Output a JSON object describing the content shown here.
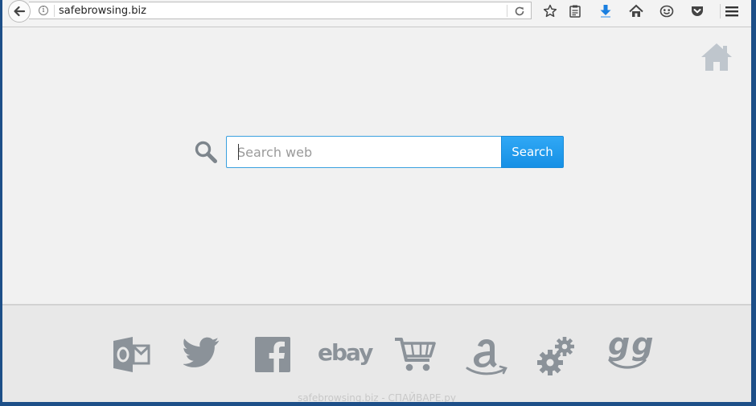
{
  "browser": {
    "url": "safebrowsing.biz",
    "toolbar_icons": [
      "bookmark-star-icon",
      "reading-list-icon",
      "download-icon",
      "home-icon",
      "hello-icon",
      "pocket-icon",
      "menu-icon"
    ]
  },
  "search": {
    "placeholder": "Search web",
    "button_label": "Search"
  },
  "footer": {
    "links": [
      "outlook",
      "twitter",
      "facebook",
      "ebay",
      "shopping-cart",
      "amazon",
      "settings",
      "gg"
    ],
    "ebay_label": "ebay",
    "gg_label": "gg",
    "watermark": "safebrowsing.biz - СПАЙВАРЕ.ру"
  },
  "colors": {
    "accent": "#1d9bf0",
    "icon_gray": "#8b9299",
    "download_blue": "#1a7fe0"
  }
}
